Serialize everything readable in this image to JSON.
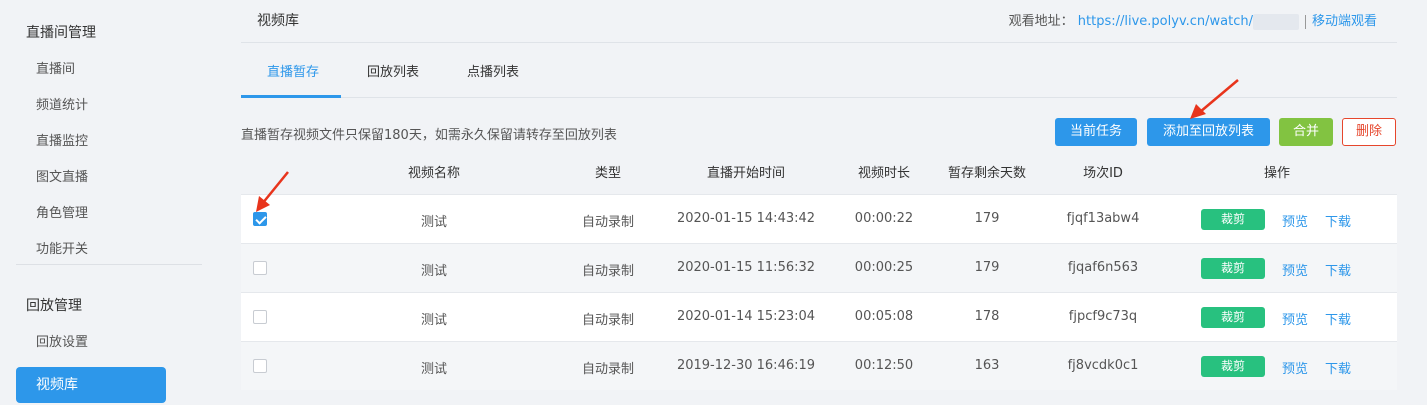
{
  "sidebar": {
    "group1": "直播间管理",
    "items1": [
      "直播间",
      "频道统计",
      "直播监控",
      "图文直播",
      "角色管理",
      "功能开关"
    ],
    "group2": "回放管理",
    "item_playback_settings": "回放设置",
    "active_item": "视频库"
  },
  "header": {
    "title": "视频库",
    "watch_label": "观看地址：",
    "watch_url": "https://live.polyv.cn/watch/",
    "mobile_link": "移动端观看"
  },
  "tabs": [
    {
      "label": "直播暂存",
      "active": true
    },
    {
      "label": "回放列表",
      "active": false
    },
    {
      "label": "点播列表",
      "active": false
    }
  ],
  "notice": "直播暂存视频文件只保留180天，如需永久保留请转存至回放列表",
  "toolbar": {
    "current_task": "当前任务",
    "add_to_playback": "添加至回放列表",
    "merge": "合并",
    "delete": "删除"
  },
  "table": {
    "headers": [
      "视频名称",
      "类型",
      "直播开始时间",
      "视频时长",
      "暂存剩余天数",
      "场次ID",
      "操作"
    ],
    "rows": [
      {
        "checked": true,
        "name": "测试",
        "type": "自动录制",
        "start": "2020-01-15 14:43:42",
        "duration": "00:00:22",
        "days": "179",
        "session": "fjqf13abw4"
      },
      {
        "checked": false,
        "name": "测试",
        "type": "自动录制",
        "start": "2020-01-15 11:56:32",
        "duration": "00:00:25",
        "days": "179",
        "session": "fjqaf6n563"
      },
      {
        "checked": false,
        "name": "测试",
        "type": "自动录制",
        "start": "2020-01-14 15:23:04",
        "duration": "00:05:08",
        "days": "178",
        "session": "fjpcf9c73q"
      },
      {
        "checked": false,
        "name": "测试",
        "type": "自动录制",
        "start": "2019-12-30 16:46:19",
        "duration": "00:12:50",
        "days": "163",
        "session": "fj8vcdk0c1"
      }
    ],
    "actions": {
      "cut": "裁剪",
      "preview": "预览",
      "download": "下载"
    }
  },
  "colors": {
    "accent": "#2d97ea",
    "merge": "#82c341",
    "delete": "#e6462c",
    "cut": "#28c17f",
    "annotation": "#e8341c"
  }
}
